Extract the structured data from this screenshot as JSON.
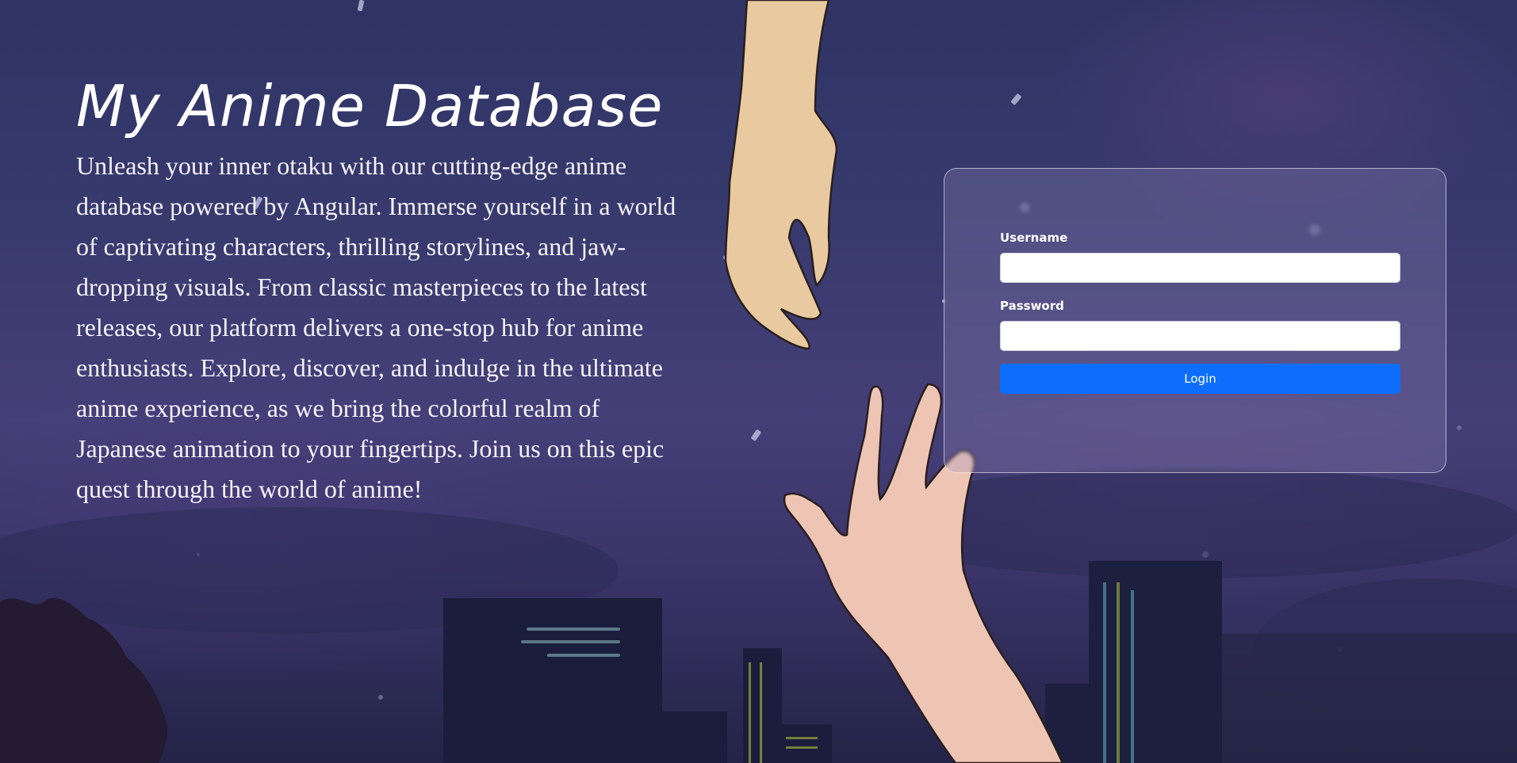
{
  "hero": {
    "title": "My Anime Database",
    "description": "Unleash your inner otaku with our cutting-edge anime database powered by Angular. Immerse yourself in a world of captivating characters, thrilling storylines, and jaw-dropping visuals. From classic masterpieces to the latest releases, our platform delivers a one-stop hub for anime enthusiasts. Explore, discover, and indulge in the ultimate anime experience, as we bring the colorful realm of Japanese animation to your fingertips. Join us on this epic quest through the world of anime!"
  },
  "login": {
    "username_label": "Username",
    "username_value": "",
    "password_label": "Password",
    "password_value": "",
    "login_button": "Login"
  },
  "colors": {
    "accent": "#0d6efd",
    "background": "#383a6e"
  },
  "background": {
    "illustration": "night-city-reaching-hands"
  }
}
